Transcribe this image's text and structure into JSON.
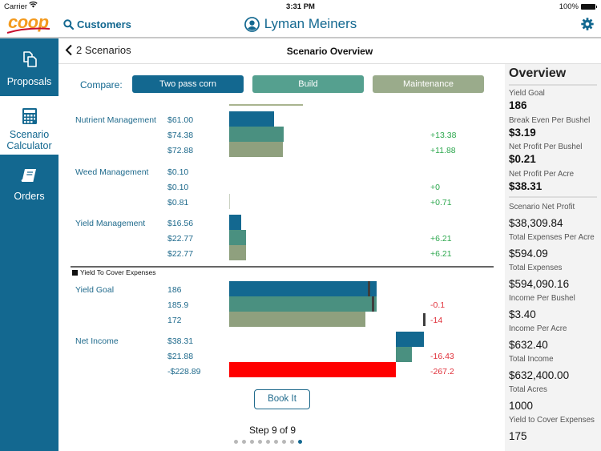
{
  "status_bar": {
    "carrier": "Carrier",
    "time": "3:31 PM",
    "battery": "100%"
  },
  "top_nav": {
    "logo_text": "coop",
    "customers_label": "Customers",
    "user_name": "Lyman Meiners",
    "icons": {
      "search": "search-icon",
      "user": "user-circle-icon",
      "settings": "gear-icon"
    }
  },
  "sidebar": {
    "items": [
      {
        "label": "Proposals",
        "icon": "documents-icon",
        "active": false
      },
      {
        "label": "Scenario Calculator",
        "label_line1": "Scenario",
        "label_line2": "Calculator",
        "icon": "calculator-icon",
        "active": true
      },
      {
        "label": "Orders",
        "icon": "book-icon",
        "active": false
      }
    ]
  },
  "sub_header": {
    "back_label": "2 Scenarios",
    "title": "Scenario Overview"
  },
  "compare": {
    "label": "Compare:",
    "scenarios": [
      {
        "name": "Two pass corn",
        "color": "#136890"
      },
      {
        "name": "Build",
        "color": "#55a08f"
      },
      {
        "name": "Maintenance",
        "color": "#9aab8b"
      }
    ]
  },
  "chart_data": {
    "type": "bar",
    "orientation": "horizontal",
    "series_names": [
      "Two pass corn",
      "Build",
      "Maintenance"
    ],
    "series_colors": [
      "#136890",
      "#4a9080",
      "#8fa07e"
    ],
    "expense_groups": [
      {
        "label": "Nutrient Management",
        "values": [
          "$61.00",
          "$74.38",
          "$72.88"
        ],
        "numeric": [
          61.0,
          74.38,
          72.88
        ],
        "diffs": [
          "",
          "+13.38",
          "+11.88"
        ]
      },
      {
        "label": "Weed Management",
        "values": [
          "$0.10",
          "$0.10",
          "$0.81"
        ],
        "numeric": [
          0.1,
          0.1,
          0.81
        ],
        "diffs": [
          "",
          "+0",
          "+0.71"
        ]
      },
      {
        "label": "Yield Management",
        "values": [
          "$16.56",
          "$22.77",
          "$22.77"
        ],
        "numeric": [
          16.56,
          22.77,
          22.77
        ],
        "diffs": [
          "",
          "+6.21",
          "+6.21"
        ]
      }
    ],
    "expense_scale_max": 400,
    "legend": "Yield To Cover Expenses",
    "yield_goal": {
      "label": "Yield Goal",
      "values": [
        "186",
        "185.9",
        "172"
      ],
      "numeric": [
        186,
        185.9,
        172
      ],
      "yield_to_cover": [
        175,
        180,
        220
      ],
      "diffs": [
        "",
        "-0.1",
        "-14"
      ],
      "scale_max": 215
    },
    "net_income": {
      "label": "Net Income",
      "values": [
        "$38.31",
        "$21.88",
        "-$228.89"
      ],
      "numeric": [
        38.31,
        21.88,
        -228.89
      ],
      "diffs": [
        "",
        "-16.43",
        "-267.2"
      ],
      "negative_color": "#ff0000",
      "scale_min": -305,
      "scale_max": 90
    }
  },
  "actions": {
    "book_it": "Book It",
    "step_text": "Step 9 of 9",
    "step_current": 9,
    "step_total": 9
  },
  "overview": {
    "title": "Overview",
    "primary": [
      {
        "label": "Yield Goal",
        "value": "186"
      },
      {
        "label": "Break Even Per Bushel",
        "value": "$3.19"
      },
      {
        "label": "Net Profit Per Bushel",
        "value": "$0.21"
      },
      {
        "label": "Net Profit Per Acre",
        "value": "$38.31"
      }
    ],
    "secondary": [
      {
        "label": "Scenario Net Profit",
        "value": "$38,309.84"
      },
      {
        "label": "Total Expenses Per Acre",
        "value": "$594.09"
      },
      {
        "label": "Total Expenses",
        "value": "$594,090.16"
      },
      {
        "label": "Income Per Bushel",
        "value": "$3.40"
      },
      {
        "label": "Income Per Acre",
        "value": "$632.40"
      },
      {
        "label": "Total Income",
        "value": "$632,400.00"
      },
      {
        "label": "Total Acres",
        "value": "1000"
      },
      {
        "label": "Yield to Cover Expenses",
        "value": "175"
      }
    ]
  }
}
